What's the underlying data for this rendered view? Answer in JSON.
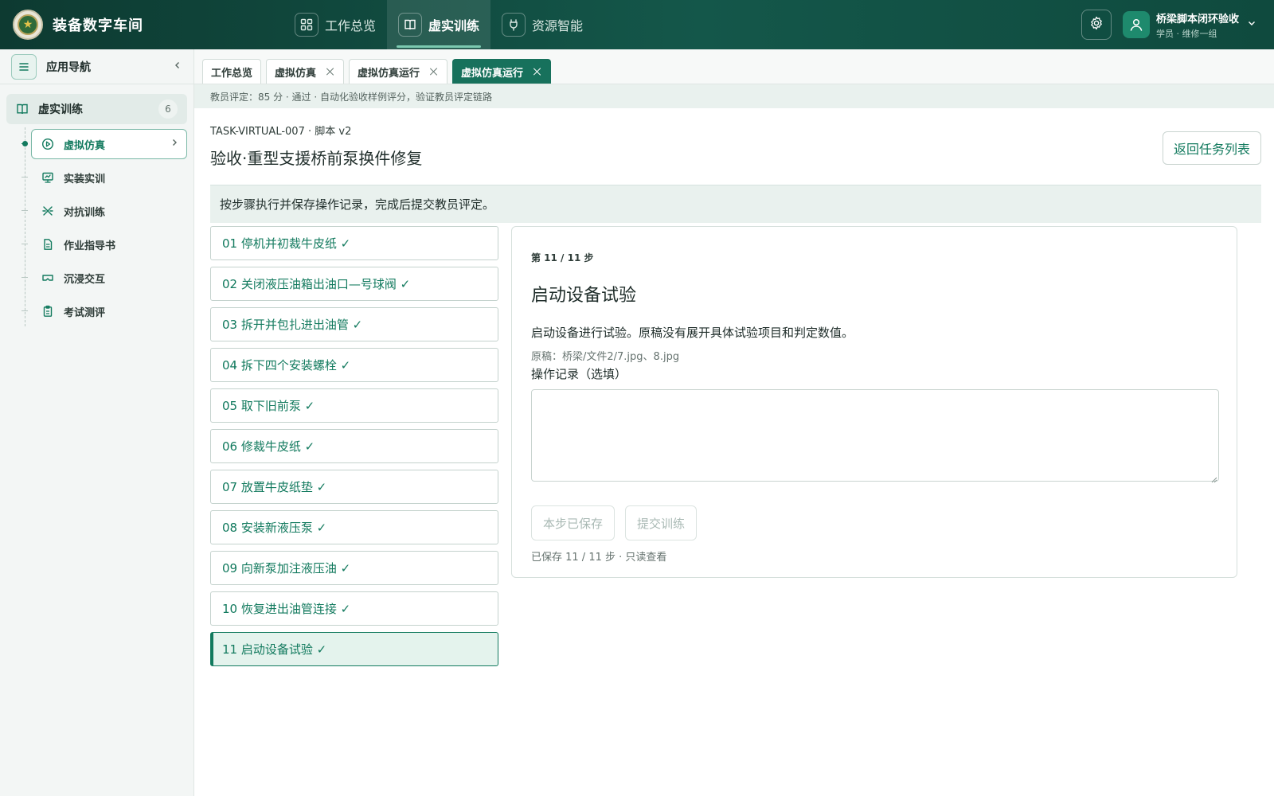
{
  "app": {
    "title": "装备数字车间",
    "logo_icon": "army-emblem-icon"
  },
  "top_nav": [
    {
      "label": "工作总览",
      "icon": "grid-icon",
      "active": false
    },
    {
      "label": "虚实训练",
      "icon": "book-icon",
      "active": true
    },
    {
      "label": "资源智能",
      "icon": "plug-icon",
      "active": false
    }
  ],
  "user": {
    "name": "桥梁脚本闭环验收",
    "role": "学员 · 维修一组"
  },
  "sidebar": {
    "title": "应用导航",
    "group": {
      "label": "虚实训练",
      "count": "6"
    },
    "items": [
      {
        "label": "虚拟仿真",
        "icon": "play-circle-icon",
        "active": true
      },
      {
        "label": "实装实训",
        "icon": "monitor-icon",
        "active": false
      },
      {
        "label": "对抗训练",
        "icon": "swords-icon",
        "active": false
      },
      {
        "label": "作业指导书",
        "icon": "document-icon",
        "active": false
      },
      {
        "label": "沉浸交互",
        "icon": "vr-headset-icon",
        "active": false
      },
      {
        "label": "考试测评",
        "icon": "clipboard-icon",
        "active": false
      }
    ]
  },
  "tabs": [
    {
      "label": "工作总览",
      "closable": false,
      "active": false
    },
    {
      "label": "虚拟仿真",
      "closable": true,
      "active": false
    },
    {
      "label": "虚拟仿真运行",
      "closable": true,
      "active": false
    },
    {
      "label": "虚拟仿真运行",
      "closable": true,
      "active": true
    }
  ],
  "eval_text": "教员评定：85 分 · 通过 · 自动化验收样例评分，验证教员评定链路",
  "task": {
    "id": "TASK-VIRTUAL-007 · 脚本 v2",
    "title": "验收·重型支援桥前泵换件修复",
    "back_label": "返回任务列表",
    "hint": "按步骤执行并保存操作记录，完成后提交教员评定。"
  },
  "steps": [
    "01 停机并初裁牛皮纸 ✓",
    "02 关闭液压油箱出油口—号球阀 ✓",
    "03 拆开并包扎进出油管 ✓",
    "04 拆下四个安装螺栓 ✓",
    "05 取下旧前泵 ✓",
    "06 修裁牛皮纸 ✓",
    "07 放置牛皮纸垫 ✓",
    "08 安装新液压泵 ✓",
    "09 向新泵加注液压油 ✓",
    "10 恢复进出油管连接 ✓",
    "11 启动设备试验 ✓"
  ],
  "active_step": 10,
  "detail": {
    "step_no": "第 11 / 11 步",
    "title": "启动设备试验",
    "description": "启动设备进行试验。原稿没有展开具体试验项目和判定数值。",
    "source": "原稿：桥梁/文件2/7.jpg、8.jpg",
    "record_label": "操作记录（选填）",
    "record_value": "",
    "save_label": "本步已保存",
    "submit_label": "提交训练",
    "saved_status": "已保存 11 / 11 步 · 只读查看"
  },
  "colors": {
    "accent": "#127a5e",
    "topbar": "#14574a",
    "active_tab": "#17715c"
  }
}
